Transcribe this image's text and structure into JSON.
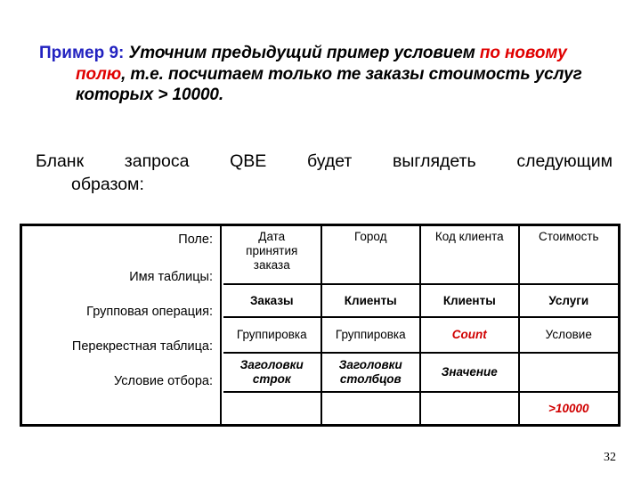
{
  "slide": {
    "page_number": "32",
    "accent_blue": "#2222c0",
    "accent_red": "#e00000"
  },
  "paragraph1": {
    "label": "Пример 9:",
    "run1": " Уточним предыдущий  пример условием ",
    "highlight": "по новому полю",
    "run2": ", т.е. посчитаем только те заказы стоимость услуг которых > 10000."
  },
  "paragraph2": {
    "line1": "Бланк запроса QBE будет выглядеть следующим",
    "line2": "образом:"
  },
  "qbe": {
    "row_labels": [
      "Поле:",
      "Имя таблицы:",
      "Групповая операция:",
      "Перекрестная таблица:",
      "Условие отбора:"
    ],
    "rows": [
      {
        "name": "field-row",
        "cells": [
          {
            "lines": [
              "Дата",
              "принятия",
              "заказа"
            ],
            "style": "plain"
          },
          {
            "lines": [
              "Город"
            ],
            "style": "plain"
          },
          {
            "lines": [
              "Код клиента"
            ],
            "style": "plain"
          },
          {
            "lines": [
              "Стоимость"
            ],
            "style": "plain"
          }
        ]
      },
      {
        "name": "table-name-row",
        "cells": [
          {
            "lines": [
              "Заказы"
            ],
            "style": "bold"
          },
          {
            "lines": [
              "Клиенты"
            ],
            "style": "bold"
          },
          {
            "lines": [
              "Клиенты"
            ],
            "style": "bold"
          },
          {
            "lines": [
              "Услуги"
            ],
            "style": "bold"
          }
        ]
      },
      {
        "name": "group-operation-row",
        "cells": [
          {
            "lines": [
              "Группировка"
            ],
            "style": "plain"
          },
          {
            "lines": [
              "Группировка"
            ],
            "style": "plain"
          },
          {
            "lines": [
              "Count"
            ],
            "style": "red-bolditalic"
          },
          {
            "lines": [
              "Условие"
            ],
            "style": "plain"
          }
        ]
      },
      {
        "name": "crosstab-row",
        "cells": [
          {
            "lines": [
              "Заголовки",
              "строк"
            ],
            "style": "bolditalic"
          },
          {
            "lines": [
              "Заголовки",
              "столбцов"
            ],
            "style": "bolditalic"
          },
          {
            "lines": [
              "Значение"
            ],
            "style": "bolditalic"
          },
          {
            "lines": [
              ""
            ],
            "style": "plain"
          }
        ]
      },
      {
        "name": "criteria-row",
        "cells": [
          {
            "lines": [
              ""
            ],
            "style": "plain"
          },
          {
            "lines": [
              ""
            ],
            "style": "plain"
          },
          {
            "lines": [
              ""
            ],
            "style": "plain"
          },
          {
            "lines": [
              ">10000"
            ],
            "style": "red-bolditalic-sm"
          }
        ]
      }
    ]
  }
}
